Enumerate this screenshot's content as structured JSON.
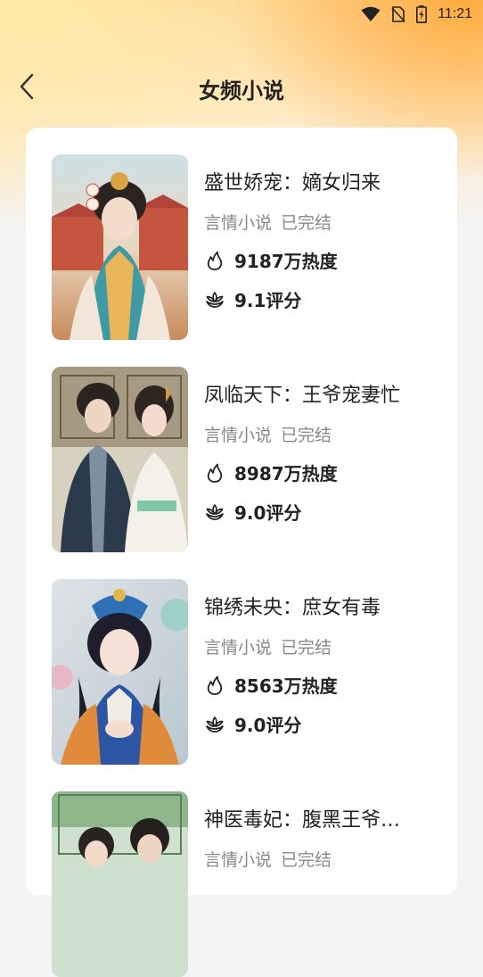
{
  "status_bar": {
    "time": "11:21",
    "icons": [
      "wifi-icon",
      "no-sim-icon",
      "battery-charging-icon"
    ]
  },
  "header": {
    "back_icon": "chevron-left-icon",
    "title": "女频小说"
  },
  "colors": {
    "background": "#f4f4f6",
    "gradient_top_left": "#ffe9b0",
    "gradient_top_right": "#ffaa3c",
    "card": "#ffffff",
    "title_text": "#222222",
    "meta_text": "#888888"
  },
  "books": [
    {
      "title": "盛世娇宠：嫡女归来",
      "genre": "言情小说",
      "status": "已完结",
      "heat": "9187万热度",
      "rating": "9.1评分"
    },
    {
      "title": "凤临天下：王爷宠妻忙",
      "genre": "言情小说",
      "status": "已完结",
      "heat": "8987万热度",
      "rating": "9.0评分"
    },
    {
      "title": "锦绣未央：庶女有毒",
      "genre": "言情小说",
      "status": "已完结",
      "heat": "8563万热度",
      "rating": "9.0评分"
    },
    {
      "title": "神医毒妃：腹黑王爷…",
      "genre": "言情小说",
      "status": "已完结",
      "heat": "",
      "rating": ""
    }
  ],
  "icons": {
    "heat": "flame-icon",
    "rating": "lotus-icon"
  }
}
